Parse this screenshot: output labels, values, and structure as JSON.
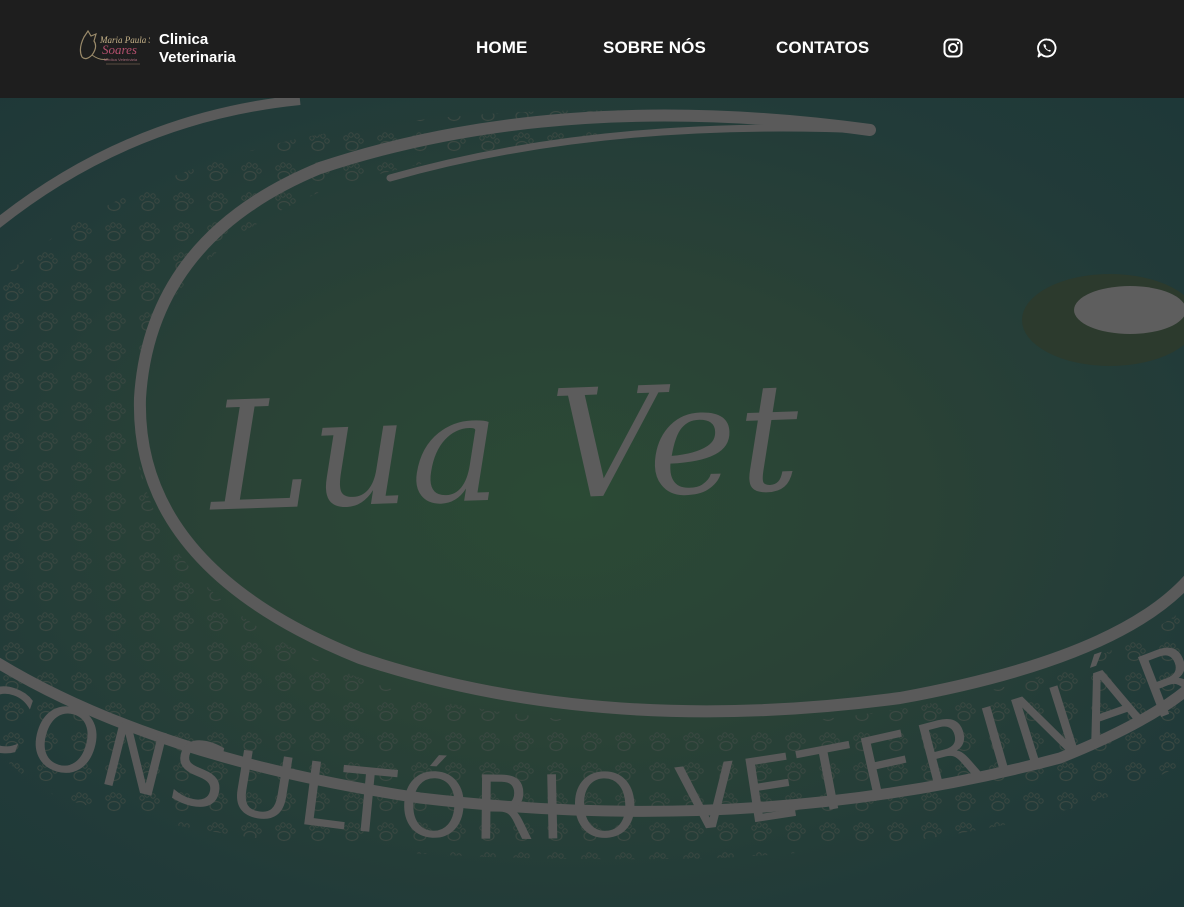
{
  "brand": {
    "logo_text": "Maria Paula Soares",
    "logo_subtext": "Médica Veterinária",
    "name_line1": "Clinica",
    "name_line2": "Veterinaria"
  },
  "nav": {
    "items": [
      {
        "label": "HOME"
      },
      {
        "label": "SOBRE NÓS"
      },
      {
        "label": "CONTATOS"
      }
    ],
    "icons": [
      "instagram-icon",
      "whatsapp-icon"
    ]
  },
  "hero": {
    "logo_script": "Lua Vet",
    "arc_text": "CONSULTÓRIO VETERINÁRIO",
    "colors": {
      "overlay": "#1e1e1e",
      "logo_gray": "#5c5c5c",
      "green_center": "#2b4a35",
      "teal_edge": "#1e3838"
    }
  }
}
